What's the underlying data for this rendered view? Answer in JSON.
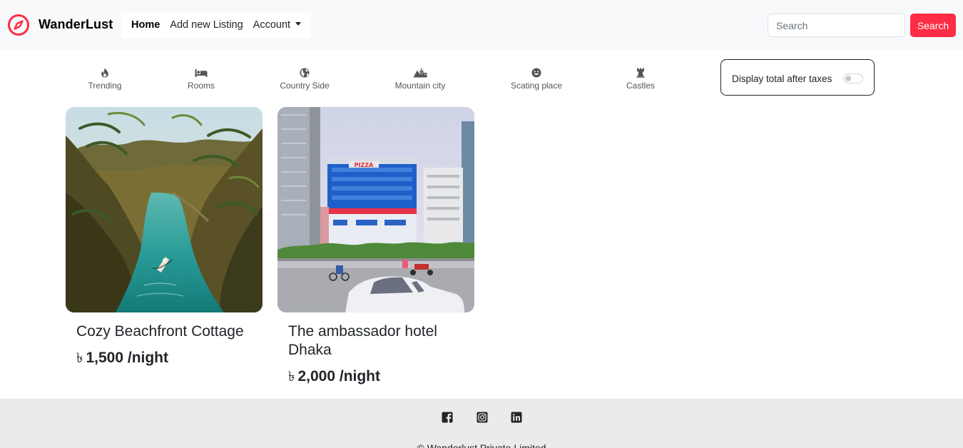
{
  "navbar": {
    "brand": "WanderLust",
    "brand_icon": "compass-icon",
    "links": [
      "Home",
      "Add new Listing",
      "Account"
    ],
    "search_placeholder": "Search",
    "search_button": "Search",
    "accent_color": "#fe2c45"
  },
  "filters": [
    {
      "label": "Trending",
      "icon": "fire-icon"
    },
    {
      "label": "Rooms",
      "icon": "bed-icon"
    },
    {
      "label": "Country Side",
      "icon": "globe-icon"
    },
    {
      "label": "Mountain city",
      "icon": "mountain-city-icon"
    },
    {
      "label": "Scating place",
      "icon": "smile-icon"
    },
    {
      "label": "Castles",
      "icon": "chess-rook-icon"
    }
  ],
  "tax_toggle": {
    "label": "Display total after taxes",
    "checked": false
  },
  "listings": [
    {
      "title": "Cozy Beachfront Cottage",
      "currency": "৳",
      "price": "1,500 /night",
      "image": "tropical-river-photo"
    },
    {
      "title": "The ambassador hotel Dhaka",
      "currency": "৳",
      "price": "2,000 /night",
      "image": "hotel-street-photo"
    }
  ],
  "footer": {
    "social": [
      "facebook-icon",
      "instagram-icon",
      "linkedin-icon"
    ],
    "copyright": "© Wanderlust Private Limited"
  }
}
